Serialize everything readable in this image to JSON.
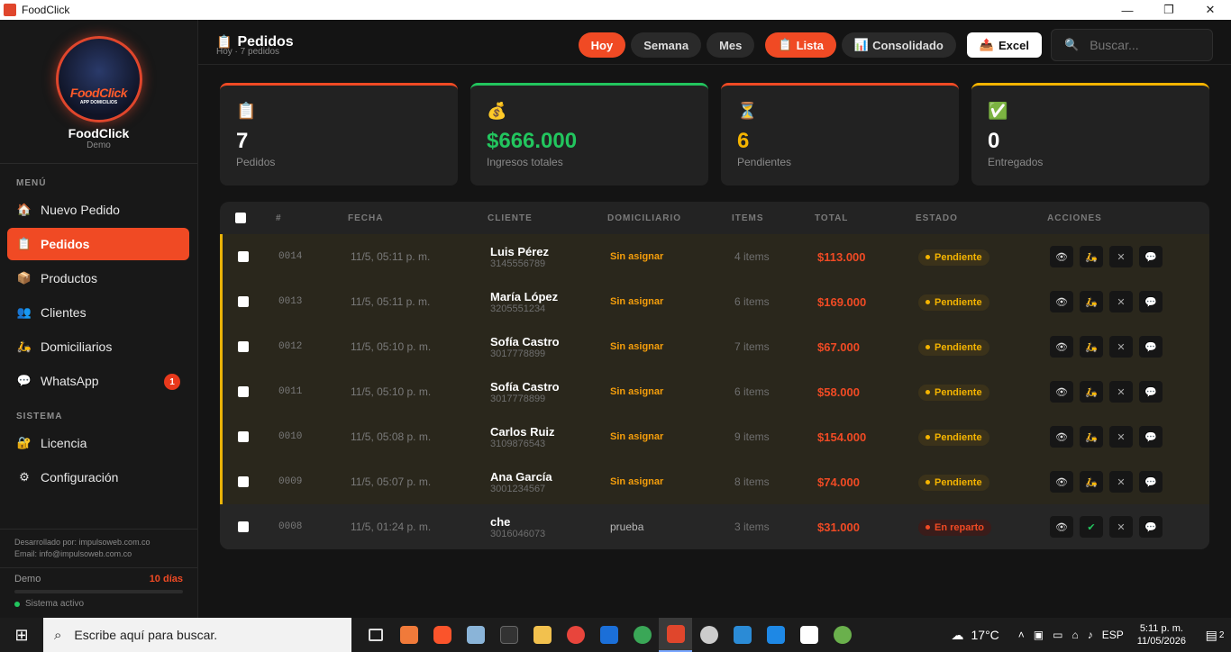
{
  "window": {
    "title": "FoodClick",
    "colors": {
      "accent": "#f04a24",
      "pending": "#f5b400",
      "success": "#22c55e"
    }
  },
  "sidebar": {
    "logo_text": "FoodClick",
    "logo_subtext": "APP DOMICILIOS",
    "brand": "FoodClick",
    "brand_sub": "Demo",
    "section_menu": "MENÚ",
    "section_system": "SISTEMA",
    "menu_items": [
      {
        "label": "Nuevo Pedido",
        "icon": "home-icon"
      },
      {
        "label": "Pedidos",
        "icon": "clipboard-icon",
        "active": true
      },
      {
        "label": "Productos",
        "icon": "box-icon"
      },
      {
        "label": "Clientes",
        "icon": "users-icon"
      },
      {
        "label": "Domiciliarios",
        "icon": "scooter-icon"
      },
      {
        "label": "WhatsApp",
        "icon": "chat-icon",
        "badge": "1"
      }
    ],
    "system_items": [
      {
        "label": "Licencia",
        "icon": "lock-icon"
      },
      {
        "label": "Configuración",
        "icon": "gear-icon"
      }
    ],
    "credit_line1": "Desarrollado por: impulsoweb.com.co",
    "credit_line2": "Email: info@impulsoweb.com.co",
    "plan": {
      "name": "Demo",
      "days": "10 días",
      "status": "Sistema activo"
    }
  },
  "header": {
    "title": "Pedidos",
    "breadcrumb": "Hoy · 7 pedidos",
    "filters": [
      "Hoy",
      "Semana",
      "Mes"
    ],
    "view_list": "Lista",
    "view_consolidated": "Consolidado",
    "export": "Excel",
    "search_placeholder": "Buscar..."
  },
  "stats": [
    {
      "value": "7",
      "label": "Pedidos",
      "icon": "clipboard-icon",
      "color": "#f04a24"
    },
    {
      "value": "$666.000",
      "label": "Ingresos totales",
      "icon": "money-bag-icon",
      "color": "#22c55e"
    },
    {
      "value": "6",
      "label": "Pendientes",
      "icon": "hourglass-icon",
      "color": "#f04a24"
    },
    {
      "value": "0",
      "label": "Entregados",
      "icon": "check-icon",
      "color": "#f5b400"
    }
  ],
  "table": {
    "headers": [
      "#",
      "FECHA",
      "CLIENTE",
      "DOMICILIARIO",
      "ITEMS",
      "TOTAL",
      "ESTADO",
      "ACCIONES"
    ],
    "rows": [
      {
        "num": "0014",
        "fecha": "11/5, 05:11 p. m.",
        "cliente": "Luis Pérez",
        "telefono": "3145556789",
        "domiciliario": "Sin asignar",
        "items": "4 items",
        "total": "$113.000",
        "estado": "Pendiente"
      },
      {
        "num": "0013",
        "fecha": "11/5, 05:11 p. m.",
        "cliente": "María López",
        "telefono": "3205551234",
        "domiciliario": "Sin asignar",
        "items": "6 items",
        "total": "$169.000",
        "estado": "Pendiente"
      },
      {
        "num": "0012",
        "fecha": "11/5, 05:10 p. m.",
        "cliente": "Sofía Castro",
        "telefono": "3017778899",
        "domiciliario": "Sin asignar",
        "items": "7 items",
        "total": "$67.000",
        "estado": "Pendiente"
      },
      {
        "num": "0011",
        "fecha": "11/5, 05:10 p. m.",
        "cliente": "Sofía Castro",
        "telefono": "3017778899",
        "domiciliario": "Sin asignar",
        "items": "6 items",
        "total": "$58.000",
        "estado": "Pendiente"
      },
      {
        "num": "0010",
        "fecha": "11/5, 05:08 p. m.",
        "cliente": "Carlos Ruiz",
        "telefono": "3109876543",
        "domiciliario": "Sin asignar",
        "items": "9 items",
        "total": "$154.000",
        "estado": "Pendiente"
      },
      {
        "num": "0009",
        "fecha": "11/5, 05:07 p. m.",
        "cliente": "Ana García",
        "telefono": "3001234567",
        "domiciliario": "Sin asignar",
        "items": "8 items",
        "total": "$74.000",
        "estado": "Pendiente"
      },
      {
        "num": "0008",
        "fecha": "11/5, 01:24 p. m.",
        "cliente": "che",
        "telefono": "3016046073",
        "domiciliario": "prueba",
        "items": "3 items",
        "total": "$31.000",
        "estado": "En reparto"
      }
    ]
  },
  "taskbar": {
    "search_placeholder": "Escribe aquí para buscar.",
    "temperature": "17°C",
    "language": "ESP",
    "time": "5:11 p. m.",
    "date": "11/05/2026",
    "notifications": "2"
  }
}
